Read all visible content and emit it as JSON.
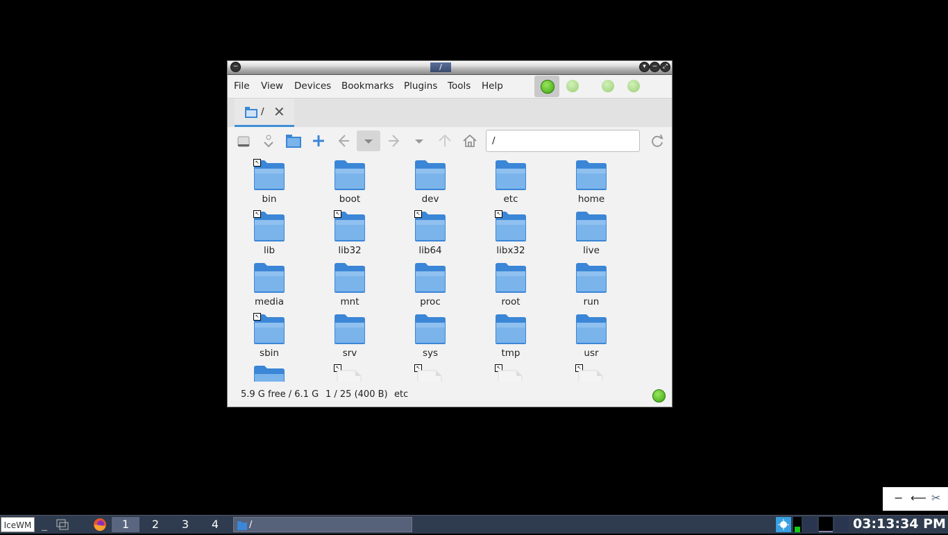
{
  "window": {
    "title": "/",
    "menu": [
      "File",
      "View",
      "Devices",
      "Bookmarks",
      "Plugins",
      "Tools",
      "Help"
    ],
    "tab_label": "/",
    "path": "/",
    "files": [
      "bin",
      "boot",
      "dev",
      "etc",
      "home",
      "lib",
      "lib32",
      "lib64",
      "libx32",
      "live",
      "media",
      "mnt",
      "proc",
      "root",
      "run",
      "sbin",
      "srv",
      "sys",
      "tmp",
      "usr"
    ],
    "symlinks": [
      "bin",
      "lib",
      "lib32",
      "lib64",
      "libx32",
      "sbin"
    ],
    "status": {
      "free": "5.9 G free / 6.1 G",
      "count": "1 / 25 (400 B)",
      "selected": "etc"
    }
  },
  "taskbar": {
    "start_label": "IceWM",
    "workspaces": [
      "1",
      "2",
      "3",
      "4"
    ],
    "task_label": "/",
    "clock": "03:13:34 PM"
  },
  "floater": {
    "minus": "−",
    "arrow": "⟵",
    "tools": "✂"
  },
  "colors": {
    "folder_blue": "#3b86d6",
    "led_green": "#5fc11e",
    "led_green_dim": "#a9d88a",
    "taskbar_bg": "#2f3b4e"
  }
}
